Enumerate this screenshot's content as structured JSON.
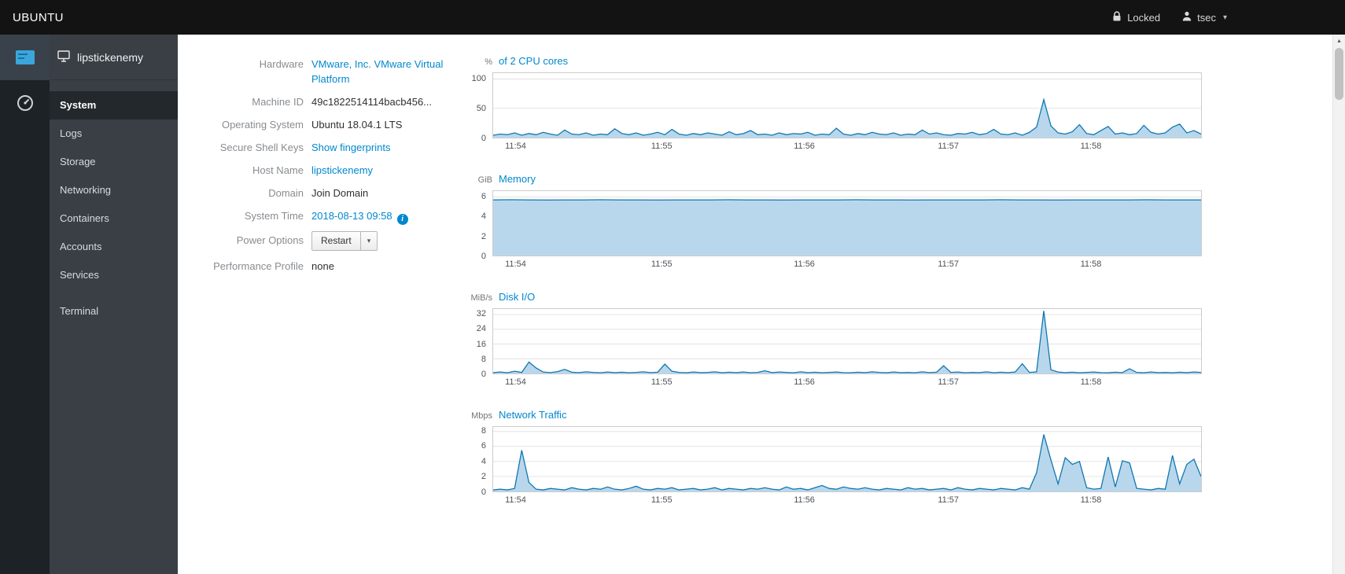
{
  "topbar": {
    "brand": "UBUNTU",
    "locked_label": "Locked",
    "user_label": "tsec"
  },
  "sidebar": {
    "host": "lipstickenemy",
    "active_item": "System",
    "nav_items": [
      "System",
      "Logs",
      "Storage",
      "Networking",
      "Containers",
      "Accounts",
      "Services",
      "Terminal"
    ]
  },
  "system_info": {
    "rows": [
      {
        "label": "Hardware",
        "value": "VMware, Inc. VMware Virtual Platform",
        "style": "link"
      },
      {
        "label": "Machine ID",
        "value": "49c1822514114bacb456...",
        "style": "text"
      },
      {
        "label": "Operating System",
        "value": "Ubuntu 18.04.1 LTS",
        "style": "text"
      },
      {
        "label": "Secure Shell Keys",
        "value": "Show fingerprints",
        "style": "link"
      },
      {
        "label": "Host Name",
        "value": "lipstickenemy",
        "style": "link"
      },
      {
        "label": "Domain",
        "value": "Join Domain",
        "style": "action"
      },
      {
        "label": "System Time",
        "value": "2018-08-13 09:58",
        "style": "link-info"
      },
      {
        "label": "Power Options",
        "value": "Restart",
        "style": "button-dropdown"
      },
      {
        "label": "Performance Profile",
        "value": "none",
        "style": "text"
      }
    ]
  },
  "colors": {
    "accent": "#0088ce",
    "chart_line": "#0f77b0",
    "chart_fill": "#b9d7ec"
  },
  "chart_data": [
    {
      "type": "area",
      "unit": "%",
      "title": "of 2 CPU cores",
      "ylim": [
        0,
        110
      ],
      "yticks": [
        0,
        50,
        100
      ],
      "x_labels": [
        "11:54",
        "11:55",
        "11:56",
        "11:57",
        "11:58"
      ],
      "x_label_fractions": [
        0.009,
        0.215,
        0.416,
        0.619,
        0.82
      ],
      "grid": true,
      "values": [
        4,
        6,
        5,
        8,
        4,
        7,
        5,
        9,
        6,
        4,
        13,
        6,
        5,
        8,
        4,
        6,
        5,
        15,
        7,
        5,
        8,
        4,
        6,
        9,
        5,
        14,
        6,
        4,
        7,
        5,
        8,
        6,
        4,
        10,
        5,
        7,
        12,
        5,
        6,
        4,
        8,
        5,
        7,
        6,
        9,
        4,
        6,
        5,
        16,
        6,
        4,
        7,
        5,
        9,
        6,
        5,
        8,
        4,
        6,
        5,
        13,
        6,
        8,
        5,
        4,
        7,
        6,
        9,
        5,
        7,
        14,
        6,
        5,
        8,
        4,
        9,
        18,
        65,
        20,
        8,
        6,
        10,
        22,
        7,
        5,
        12,
        19,
        6,
        8,
        5,
        7,
        21,
        9,
        6,
        8,
        18,
        23,
        8,
        12,
        6
      ]
    },
    {
      "type": "area",
      "unit": "GiB",
      "title": "Memory",
      "ylim": [
        0,
        6.6
      ],
      "yticks": [
        0,
        2,
        4,
        6
      ],
      "x_labels": [
        "11:54",
        "11:55",
        "11:56",
        "11:57",
        "11:58"
      ],
      "x_label_fractions": [
        0.009,
        0.215,
        0.416,
        0.619,
        0.82
      ],
      "grid": true,
      "values": [
        5.7,
        5.71,
        5.7,
        5.69,
        5.7,
        5.7,
        5.71,
        5.7,
        5.7,
        5.69,
        5.7,
        5.7,
        5.7,
        5.71,
        5.7,
        5.7,
        5.69,
        5.7,
        5.7,
        5.7,
        5.71,
        5.7,
        5.7,
        5.69,
        5.7,
        5.7,
        5.7,
        5.7,
        5.71,
        5.7,
        5.7,
        5.69,
        5.7,
        5.7,
        5.7,
        5.7,
        5.71,
        5.7,
        5.7,
        5.7
      ]
    },
    {
      "type": "area",
      "unit": "MiB/s",
      "title": "Disk I/O",
      "ylim": [
        0,
        35
      ],
      "yticks": [
        0,
        8,
        16,
        24,
        32
      ],
      "x_labels": [
        "11:54",
        "11:55",
        "11:56",
        "11:57",
        "11:58"
      ],
      "x_label_fractions": [
        0.009,
        0.215,
        0.416,
        0.619,
        0.82
      ],
      "grid": true,
      "values": [
        0.5,
        0.8,
        0.4,
        1.2,
        0.6,
        6.2,
        3,
        0.8,
        0.5,
        1,
        2.2,
        0.7,
        0.5,
        0.9,
        0.6,
        0.4,
        0.8,
        0.5,
        0.7,
        0.4,
        0.6,
        0.9,
        0.5,
        0.7,
        5.1,
        1.2,
        0.6,
        0.4,
        0.8,
        0.5,
        0.6,
        0.9,
        0.4,
        0.7,
        0.5,
        0.8,
        0.4,
        0.6,
        1.5,
        0.5,
        0.8,
        0.6,
        0.4,
        0.9,
        0.5,
        0.7,
        0.4,
        0.6,
        0.8,
        0.5,
        0.4,
        0.7,
        0.5,
        0.9,
        0.6,
        0.4,
        0.8,
        0.5,
        0.6,
        0.4,
        0.9,
        0.5,
        0.7,
        4.2,
        0.6,
        0.8,
        0.4,
        0.6,
        0.5,
        0.9,
        0.4,
        0.7,
        0.5,
        0.8,
        5.3,
        0.6,
        0.9,
        34,
        2,
        0.8,
        0.5,
        0.7,
        0.4,
        0.6,
        0.8,
        0.5,
        0.4,
        0.7,
        0.5,
        2.6,
        0.6,
        0.4,
        0.8,
        0.5,
        0.6,
        0.4,
        0.7,
        0.5,
        0.8,
        0.6
      ]
    },
    {
      "type": "area",
      "unit": "Mbps",
      "title": "Network Traffic",
      "ylim": [
        0,
        8.6
      ],
      "yticks": [
        0,
        2,
        4,
        6,
        8
      ],
      "x_labels": [
        "11:54",
        "11:55",
        "11:56",
        "11:57",
        "11:58"
      ],
      "x_label_fractions": [
        0.009,
        0.215,
        0.416,
        0.619,
        0.82
      ],
      "grid": true,
      "values": [
        0.2,
        0.3,
        0.2,
        0.4,
        5.5,
        1.2,
        0.3,
        0.2,
        0.4,
        0.3,
        0.2,
        0.5,
        0.3,
        0.2,
        0.4,
        0.3,
        0.6,
        0.3,
        0.2,
        0.4,
        0.7,
        0.3,
        0.2,
        0.4,
        0.3,
        0.5,
        0.2,
        0.3,
        0.4,
        0.2,
        0.3,
        0.5,
        0.2,
        0.4,
        0.3,
        0.2,
        0.4,
        0.3,
        0.5,
        0.3,
        0.2,
        0.6,
        0.3,
        0.4,
        0.2,
        0.5,
        0.8,
        0.4,
        0.3,
        0.6,
        0.4,
        0.3,
        0.5,
        0.3,
        0.2,
        0.4,
        0.3,
        0.2,
        0.5,
        0.3,
        0.4,
        0.2,
        0.3,
        0.4,
        0.2,
        0.5,
        0.3,
        0.2,
        0.4,
        0.3,
        0.2,
        0.4,
        0.3,
        0.2,
        0.5,
        0.3,
        2.5,
        7.6,
        4.2,
        1,
        4.5,
        3.6,
        4,
        0.5,
        0.3,
        0.4,
        4.6,
        0.6,
        4.1,
        3.8,
        0.4,
        0.3,
        0.2,
        0.4,
        0.3,
        4.8,
        1,
        3.6,
        4.3,
        2
      ]
    }
  ]
}
